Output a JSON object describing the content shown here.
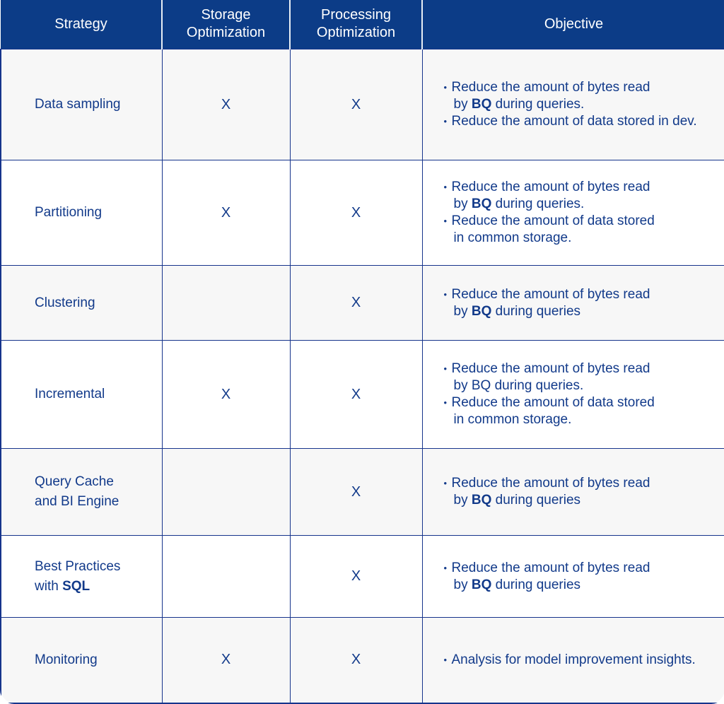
{
  "table": {
    "headers": [
      {
        "label": "Strategy"
      },
      {
        "label": "Storage\nOptimization",
        "line1": "Storage",
        "line2": "Optimization"
      },
      {
        "label": "Processing\nOptimization",
        "line1": "Processing",
        "line2": "Optimization"
      },
      {
        "label": "Objective"
      }
    ],
    "colors": {
      "header_bg": "#0c3c87",
      "header_text": "#ffffff",
      "body_text": "#123a8a",
      "border": "#16348c",
      "row_odd_bg": "#f7f7f7",
      "row_even_bg": "#ffffff"
    },
    "mark": "X",
    "rows": [
      {
        "strategy_line1": "Data sampling",
        "strategy_line2": "",
        "storage": "X",
        "processing": "X",
        "objectives": [
          {
            "pre": "Reduce the amount of bytes read",
            "cont_pre": "by ",
            "bold": "BQ",
            "cont_post": " during queries."
          },
          {
            "pre": "Reduce the amount of data stored in dev.",
            "cont_pre": "",
            "bold": "",
            "cont_post": ""
          }
        ]
      },
      {
        "strategy_line1": "Partitioning",
        "strategy_line2": "",
        "storage": "X",
        "processing": "X",
        "objectives": [
          {
            "pre": "Reduce the amount of bytes read",
            "cont_pre": "by ",
            "bold": "BQ",
            "cont_post": " during queries."
          },
          {
            "pre": "Reduce the amount of data stored",
            "cont_pre": "in common storage.",
            "bold": "",
            "cont_post": ""
          }
        ]
      },
      {
        "strategy_line1": "Clustering",
        "strategy_line2": "",
        "storage": "",
        "processing": "X",
        "objectives": [
          {
            "pre": "Reduce the amount of bytes read",
            "cont_pre": "by ",
            "bold": "BQ",
            "cont_post": " during queries"
          }
        ]
      },
      {
        "strategy_line1": "Incremental",
        "strategy_line2": "",
        "storage": "X",
        "processing": "X",
        "objectives": [
          {
            "pre": "Reduce the amount of bytes read",
            "cont_pre": "by BQ during queries.",
            "bold": "",
            "cont_post": ""
          },
          {
            "pre": "Reduce the amount of data stored",
            "cont_pre": "in common storage.",
            "bold": "",
            "cont_post": ""
          }
        ]
      },
      {
        "strategy_line1": "Query Cache",
        "strategy_line2": "and BI Engine",
        "storage": "",
        "processing": "X",
        "objectives": [
          {
            "pre": "Reduce the amount of bytes read",
            "cont_pre": "by ",
            "bold": "BQ",
            "cont_post": " during queries"
          }
        ]
      },
      {
        "strategy_line1": "Best Practices",
        "strategy_line2": "with ",
        "strategy_line2_bold": "SQL",
        "storage": "",
        "processing": "X",
        "objectives": [
          {
            "pre": "Reduce the amount of bytes read",
            "cont_pre": "by ",
            "bold": "BQ",
            "cont_post": " during queries"
          }
        ]
      },
      {
        "strategy_line1": "Monitoring",
        "strategy_line2": "",
        "storage": "X",
        "processing": "X",
        "objectives": [
          {
            "pre": "Analysis for model improvement insights.",
            "cont_pre": "",
            "bold": "",
            "cont_post": ""
          }
        ]
      }
    ]
  }
}
